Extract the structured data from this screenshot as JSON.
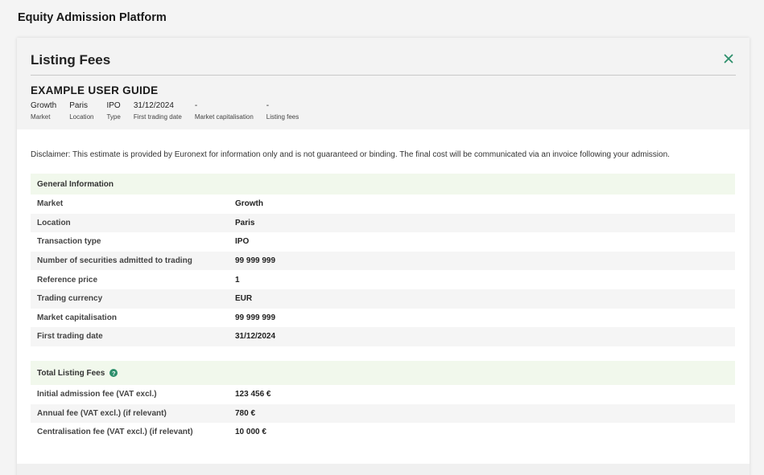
{
  "app": {
    "title": "Equity Admission Platform"
  },
  "modal": {
    "title": "Listing Fees",
    "close_icon": "close-icon",
    "guide_title": "EXAMPLE USER GUIDE",
    "summary": [
      {
        "value": "Growth",
        "label": "Market"
      },
      {
        "value": "Paris",
        "label": "Location"
      },
      {
        "value": "IPO",
        "label": "Type"
      },
      {
        "value": "31/12/2024",
        "label": "First trading date"
      },
      {
        "value": "-",
        "label": "Market capitalisation"
      },
      {
        "value": "-",
        "label": "Listing fees"
      }
    ],
    "disclaimer": "Disclaimer: This estimate is provided by Euronext for information only and is not guaranteed or binding. The final cost will be communicated via an invoice following your admission."
  },
  "general_information": {
    "heading": "General Information",
    "rows": [
      {
        "label": "Market",
        "value": "Growth"
      },
      {
        "label": "Location",
        "value": "Paris"
      },
      {
        "label": "Transaction type",
        "value": "IPO"
      },
      {
        "label": "Number of securities admitted to trading",
        "value": "99 999 999"
      },
      {
        "label": "Reference price",
        "value": "1"
      },
      {
        "label": "Trading currency",
        "value": "EUR"
      },
      {
        "label": "Market capitalisation",
        "value": "99 999 999"
      },
      {
        "label": "First trading date",
        "value": "31/12/2024"
      }
    ]
  },
  "total_listing_fees": {
    "heading": "Total Listing Fees",
    "help_icon": "question-icon",
    "help_glyph": "?",
    "rows": [
      {
        "label": "Initial admission fee (VAT excl.)",
        "value": "123 456 €"
      },
      {
        "label": "Annual fee (VAT excl.) (if relevant)",
        "value": "780 €"
      },
      {
        "label": "Centralisation fee (VAT excl.) (if relevant)",
        "value": "10 000 €"
      }
    ]
  },
  "colors": {
    "accent": "#2d8f6b",
    "section_background": "#f1f8ec",
    "header_background": "#f3f3f3"
  }
}
